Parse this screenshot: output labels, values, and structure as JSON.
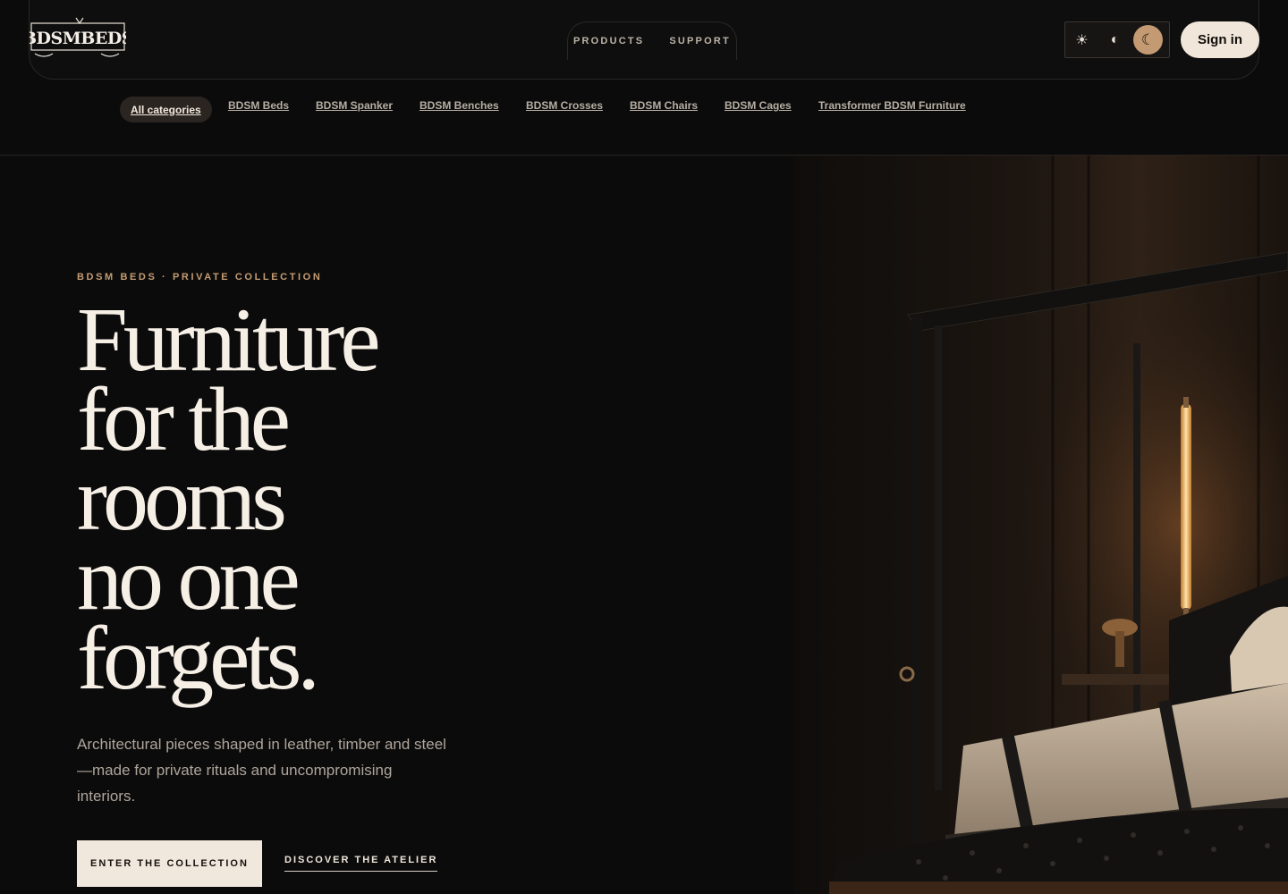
{
  "brand": {
    "logo_text": "BDSMBEDS"
  },
  "header": {
    "nav": [
      {
        "label": "PRODUCTS"
      },
      {
        "label": "SUPPORT"
      }
    ],
    "theme_modes": [
      {
        "name": "light",
        "icon": "sun-icon",
        "glyph": "☀"
      },
      {
        "name": "auto",
        "icon": "contrast-icon",
        "glyph": "◐"
      },
      {
        "name": "dark",
        "icon": "moon-icon",
        "glyph": "☾",
        "selected": true
      }
    ],
    "signin_label": "Sign in"
  },
  "categories": [
    {
      "label": "All categories",
      "active": true
    },
    {
      "label": "BDSM Beds"
    },
    {
      "label": "BDSM Spanker"
    },
    {
      "label": "BDSM Benches"
    },
    {
      "label": "BDSM Crosses"
    },
    {
      "label": "BDSM Chairs"
    },
    {
      "label": "BDSM Cages"
    },
    {
      "label": "Transformer BDSM Furniture"
    }
  ],
  "hero": {
    "kicker": "BDSM BEDS · PRIVATE COLLECTION",
    "headline_lines": [
      "Furniture",
      "for the",
      "rooms",
      "no one",
      "forgets."
    ],
    "lede": "Architectural pieces shaped in leather, timber and steel—made for private rituals and uncompromising interiors.",
    "cta_primary": "ENTER THE COLLECTION",
    "cta_secondary": "DISCOVER THE ATELIER"
  },
  "colors": {
    "background": "#0b0b0b",
    "accent": "#c49c72",
    "cream": "#f1e8dd"
  }
}
